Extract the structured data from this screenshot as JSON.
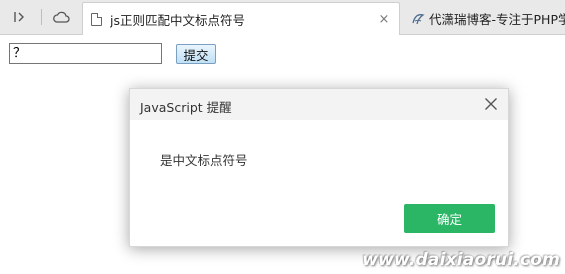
{
  "browser": {
    "nav": {
      "sidebar_icon": "sidebar-toggle-icon",
      "cloud_icon": "cloud-icon"
    },
    "tabs": [
      {
        "title": "js正则匹配中文标点符号",
        "icon": "document-icon",
        "close": "×",
        "active": true
      },
      {
        "title": "代潇瑞博客-专注于PHP学",
        "icon": "site-logo-icon",
        "active": false
      }
    ]
  },
  "page": {
    "input_value": "？",
    "submit_label": "提交"
  },
  "dialog": {
    "title": "JavaScript 提醒",
    "message": "是中文标点符号",
    "ok_label": "确定",
    "ok_color": "#2bb665"
  },
  "watermark": "www.daixiaorui.com"
}
